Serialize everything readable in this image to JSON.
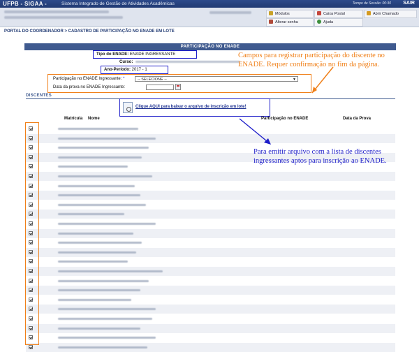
{
  "topbar": {
    "brand": "UFPB - SIGAA -",
    "system_name": "Sistema Integrado de Gestão de Atividades Acadêmicas",
    "session_timer": "Tempo de Sessão: 00:30",
    "logout_label": "SAIR"
  },
  "menu": {
    "modulos": "Módulos",
    "caixa_postal": "Caixa Postal",
    "abrir_chamado": "Abrir Chamado",
    "alterar_senha": "Alterar senha",
    "ajuda": "Ajuda"
  },
  "breadcrumb": "Portal do Coordenador > Cadastro de Participação no ENADE em Lote",
  "panel_caption": "Participação no ENADE",
  "form": {
    "tipo_label": "Tipo do ENADE:",
    "tipo_value": "ENADE INGRESSANTE",
    "curso_label": "Curso:",
    "ano_label": "Ano-Período:",
    "ano_value": "2017 - 1",
    "participacao_label": "Participação no ENADE Ingressante:",
    "required_mark": "*",
    "select_value": "-- SELECIONE --",
    "data_label": "Data da prova no ENADE Ingressante:"
  },
  "section_title": "Discentes",
  "download_link": "Clique AQUI para baixar o arquivo de inscrição em lote!",
  "table": {
    "headers": [
      "Matrícula",
      "Nome",
      "Participação no ENADE",
      "Data da Prova"
    ],
    "row_count": 24
  },
  "annotations": {
    "orange": "Campos para registrar participação do discente no ENADE. Requer confirmação no fim da página.",
    "blue": "Para emitir arquivo com a lista de discentes ingressantes aptos para inscrição ao ENADE."
  },
  "colors": {
    "topbar": "#203a73",
    "caption": "#3f5a8f",
    "annotation_blue": "#1d1dc9",
    "annotation_orange": "#f08019"
  }
}
